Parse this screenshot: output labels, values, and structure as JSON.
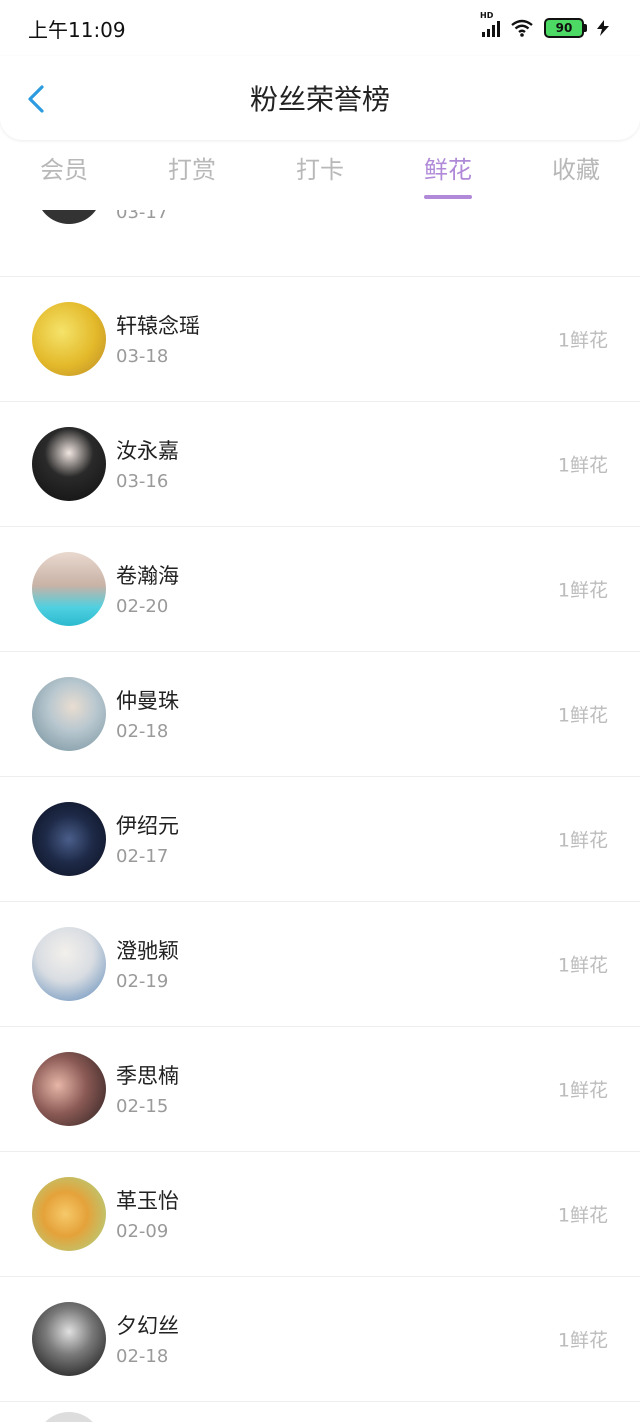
{
  "status_bar": {
    "time": "上午11:09",
    "battery_level": "90",
    "network_badge": "HD"
  },
  "header": {
    "title": "粉丝荣誉榜"
  },
  "tabs": [
    {
      "label": "会员",
      "active": false
    },
    {
      "label": "打赏",
      "active": false
    },
    {
      "label": "打卡",
      "active": false
    },
    {
      "label": "鲜花",
      "active": true
    },
    {
      "label": "收藏",
      "active": false
    }
  ],
  "colors": {
    "accent": "#b08ad8",
    "back_icon": "#2c9be0"
  },
  "partial_top_date": "03-17",
  "rows": [
    {
      "name": "轩辕念瑶",
      "date": "03-18",
      "count": "1鲜花",
      "avatar": "yellow-cartoon"
    },
    {
      "name": "汝永嘉",
      "date": "03-16",
      "count": "1鲜花",
      "avatar": "dark-anime-boy"
    },
    {
      "name": "卷瀚海",
      "date": "02-20",
      "count": "1鲜花",
      "avatar": "photo-collage"
    },
    {
      "name": "仲曼珠",
      "date": "02-18",
      "count": "1鲜花",
      "avatar": "girl-with-flower"
    },
    {
      "name": "伊绍元",
      "date": "02-17",
      "count": "1鲜花",
      "avatar": "dark-rose"
    },
    {
      "name": "澄驰颖",
      "date": "02-19",
      "count": "1鲜花",
      "avatar": "girl-with-hat"
    },
    {
      "name": "季思楠",
      "date": "02-15",
      "count": "1鲜花",
      "avatar": "woman-face"
    },
    {
      "name": "革玉怡",
      "date": "02-09",
      "count": "1鲜花",
      "avatar": "cartoon-pig"
    },
    {
      "name": "夕幻丝",
      "date": "02-18",
      "count": "1鲜花",
      "avatar": "mono-silhouette"
    }
  ]
}
